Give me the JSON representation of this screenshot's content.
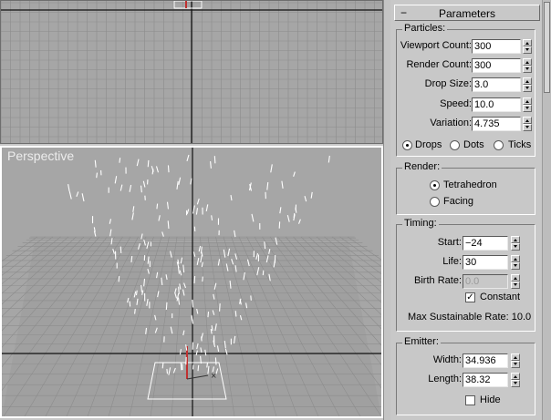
{
  "viewports": {
    "perspective_label": "Perspective"
  },
  "panel": {
    "rollout_title": "Parameters",
    "rollout_minus": "−",
    "particles": {
      "group_label": "Particles:",
      "viewport_count": {
        "label": "Viewport Count:",
        "value": "300"
      },
      "render_count": {
        "label": "Render Count:",
        "value": "300"
      },
      "drop_size": {
        "label": "Drop Size:",
        "value": "3.0"
      },
      "speed": {
        "label": "Speed:",
        "value": "10.0"
      },
      "variation": {
        "label": "Variation:",
        "value": "4.735"
      },
      "shape_options": [
        {
          "label": "Drops",
          "selected": true
        },
        {
          "label": "Dots",
          "selected": false
        },
        {
          "label": "Ticks",
          "selected": false
        }
      ]
    },
    "render": {
      "group_label": "Render:",
      "options": [
        {
          "label": "Tetrahedron",
          "selected": true
        },
        {
          "label": "Facing",
          "selected": false
        }
      ]
    },
    "timing": {
      "group_label": "Timing:",
      "start": {
        "label": "Start:",
        "value": "−24"
      },
      "life": {
        "label": "Life:",
        "value": "30"
      },
      "birth_rate": {
        "label": "Birth Rate:",
        "value": "0.0"
      },
      "constant": {
        "label": "Constant",
        "checked": true
      },
      "max_sustainable": "Max Sustainable Rate: 10.0"
    },
    "emitter": {
      "group_label": "Emitter:",
      "width": {
        "label": "Width:",
        "value": "34.936"
      },
      "length": {
        "label": "Length:",
        "value": "38.32"
      },
      "hide": {
        "label": "Hide",
        "checked": false
      }
    }
  },
  "colors": {
    "viewport_bg": "#a6a6a6",
    "grid": "#8c8c8c",
    "axis": "#111111",
    "particle": "#ffffff",
    "panel_bg": "#c8c8c8"
  }
}
